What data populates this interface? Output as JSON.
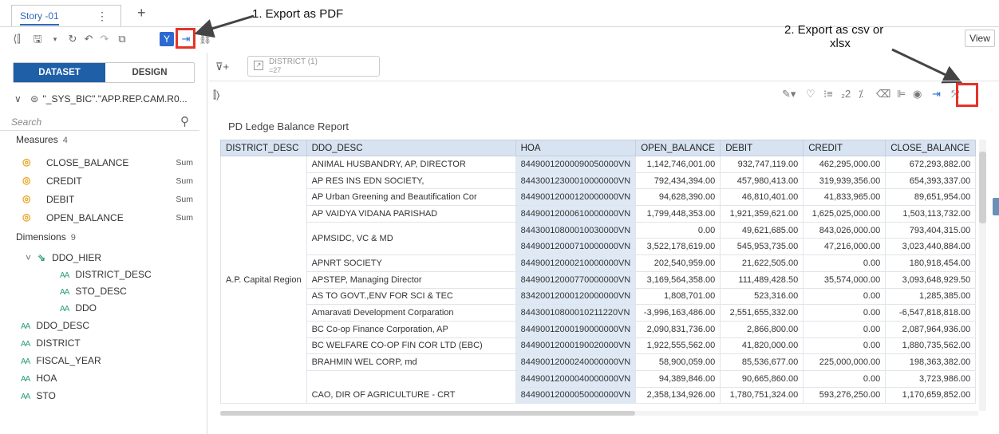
{
  "story_tab": {
    "label": "Story -01",
    "menu_icon": "more-vertical-icon",
    "add_icon": "plus-icon"
  },
  "toolbar": {
    "icons": [
      "panel-collapse-icon",
      "save-icon",
      "dropdown-icon",
      "refresh-icon",
      "undo-icon",
      "redo-icon",
      "copy-icon",
      "filter-icon",
      "export-icon",
      "link-icon"
    ],
    "view_label": "View"
  },
  "annotations": {
    "export_pdf": "1. Export as PDF",
    "export_csv_line1": "2. Export as csv or",
    "export_csv_line2": "xlsx",
    "highlight_color": "#e5332a"
  },
  "left_panel": {
    "tabs": {
      "dataset": "DATASET",
      "design": "DESIGN"
    },
    "dataset_name": "\"_SYS_BIC\".\"APP.REP.CAM.R0...",
    "search_placeholder": "Search",
    "measures": {
      "heading": "Measures",
      "count": "4",
      "items": [
        {
          "label": "CLOSE_BALANCE",
          "agg": "Sum"
        },
        {
          "label": "CREDIT",
          "agg": "Sum"
        },
        {
          "label": "DEBIT",
          "agg": "Sum"
        },
        {
          "label": "OPEN_BALANCE",
          "agg": "Sum"
        }
      ]
    },
    "dimensions": {
      "heading": "Dimensions",
      "count": "9",
      "hierarchy": "DDO_HIER",
      "hier_children": [
        "DISTRICT_DESC",
        "STO_DESC",
        "DDO"
      ],
      "items": [
        "DDO_DESC",
        "DISTRICT",
        "FISCAL_YEAR",
        "HOA",
        "STO"
      ]
    }
  },
  "filter_chip": {
    "name": "DISTRICT (1)",
    "value": "=27"
  },
  "report": {
    "title": "PD Ledge Balance Report",
    "columns": [
      "DISTRICT_DESC",
      "DDO_DESC",
      "HOA",
      "OPEN_BALANCE",
      "DEBIT",
      "CREDIT",
      "CLOSE_BALANCE"
    ],
    "district": "A.P. Capital Region",
    "rows": [
      {
        "ddo": "ANIMAL HUSBANDRY, AP, DIRECTOR",
        "hoa": "84490012000090050000VN",
        "open": "1,142,746,001.00",
        "debit": "932,747,119.00",
        "credit": "462,295,000.00",
        "close": "672,293,882.00"
      },
      {
        "ddo": "AP RES INS EDN SOCIETY,",
        "hoa": "84430012300010000000VN",
        "open": "792,434,394.00",
        "debit": "457,980,413.00",
        "credit": "319,939,356.00",
        "close": "654,393,337.00"
      },
      {
        "ddo": "AP Urban Greening and Beautification Cor",
        "hoa": "84490012000120000000VN",
        "open": "94,628,390.00",
        "debit": "46,810,401.00",
        "credit": "41,833,965.00",
        "close": "89,651,954.00"
      },
      {
        "ddo": "AP VAIDYA VIDANA PARISHAD",
        "hoa": "84490012000610000000VN",
        "open": "1,799,448,353.00",
        "debit": "1,921,359,621.00",
        "credit": "1,625,025,000.00",
        "close": "1,503,113,732.00"
      },
      {
        "ddo": "APMSIDC, VC & MD",
        "hoa": "84430010800010030000VN",
        "open": "0.00",
        "debit": "49,621,685.00",
        "credit": "843,026,000.00",
        "close": "793,404,315.00"
      },
      {
        "ddo": "",
        "hoa": "84490012000710000000VN",
        "open": "3,522,178,619.00",
        "debit": "545,953,735.00",
        "credit": "47,216,000.00",
        "close": "3,023,440,884.00"
      },
      {
        "ddo": "APNRT SOCIETY",
        "hoa": "84490012000210000000VN",
        "open": "202,540,959.00",
        "debit": "21,622,505.00",
        "credit": "0.00",
        "close": "180,918,454.00"
      },
      {
        "ddo": "APSTEP, Managing Director",
        "hoa": "84490012000770000000VN",
        "open": "3,169,564,358.00",
        "debit": "111,489,428.50",
        "credit": "35,574,000.00",
        "close": "3,093,648,929.50"
      },
      {
        "ddo": "AS TO GOVT.,ENV FOR SCI & TEC",
        "hoa": "83420012000120000000VN",
        "open": "1,808,701.00",
        "debit": "523,316.00",
        "credit": "0.00",
        "close": "1,285,385.00"
      },
      {
        "ddo": "Amaravati Development Corparation",
        "hoa": "84430010800010211220VN",
        "open": "-3,996,163,486.00",
        "debit": "2,551,655,332.00",
        "credit": "0.00",
        "close": "-6,547,818,818.00"
      },
      {
        "ddo": "BC Co-op Finance Corporation, AP",
        "hoa": "84490012000190000000VN",
        "open": "2,090,831,736.00",
        "debit": "2,866,800.00",
        "credit": "0.00",
        "close": "2,087,964,936.00"
      },
      {
        "ddo": "BC WELFARE CO-OP FIN COR LTD (EBC)",
        "hoa": "84490012000190020000VN",
        "open": "1,922,555,562.00",
        "debit": "41,820,000.00",
        "credit": "0.00",
        "close": "1,880,735,562.00"
      },
      {
        "ddo": "BRAHMIN WEL CORP, md",
        "hoa": "84490012000240000000VN",
        "open": "58,900,059.00",
        "debit": "85,536,677.00",
        "credit": "225,000,000.00",
        "close": "198,363,382.00"
      },
      {
        "ddo": "",
        "hoa": "84490012000040000000VN",
        "open": "94,389,846.00",
        "debit": "90,665,860.00",
        "credit": "0.00",
        "close": "3,723,986.00"
      },
      {
        "ddo": "CAO, DIR OF AGRICULTURE - CRT",
        "hoa": "84490012000050000000VN",
        "open": "2,358,134,926.00",
        "debit": "1,780,751,324.00",
        "credit": "593,276,250.00",
        "close": "1,170,659,852.00"
      }
    ]
  }
}
